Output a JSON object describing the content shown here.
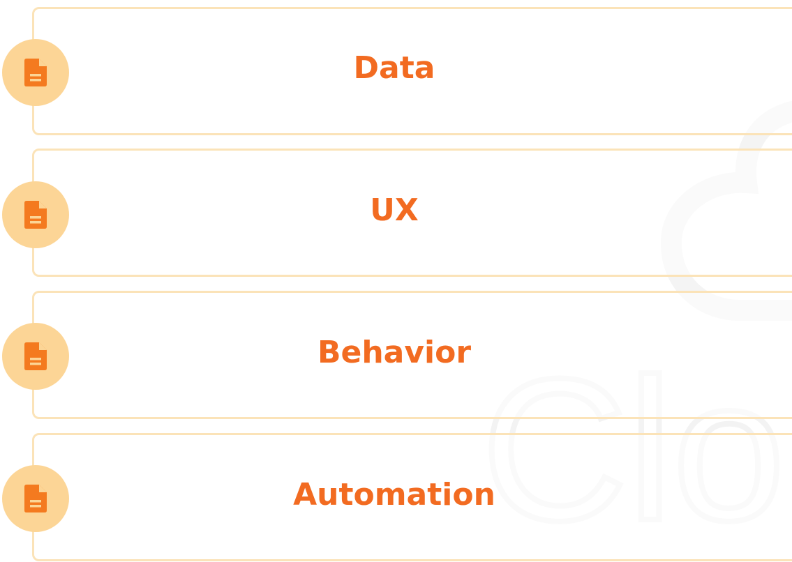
{
  "items": [
    {
      "label": "Data",
      "icon": "document-icon"
    },
    {
      "label": "UX",
      "icon": "document-icon"
    },
    {
      "label": "Behavior",
      "icon": "document-icon"
    },
    {
      "label": "Automation",
      "icon": "document-icon"
    }
  ],
  "watermark": {
    "text": "Clou",
    "description_icon": "cloud-logo-icon"
  },
  "colors": {
    "accent": "#f26b21",
    "badge_bg": "#fcd596",
    "card_border": "#fbe3b8",
    "watermark": "#f5f5f5"
  }
}
